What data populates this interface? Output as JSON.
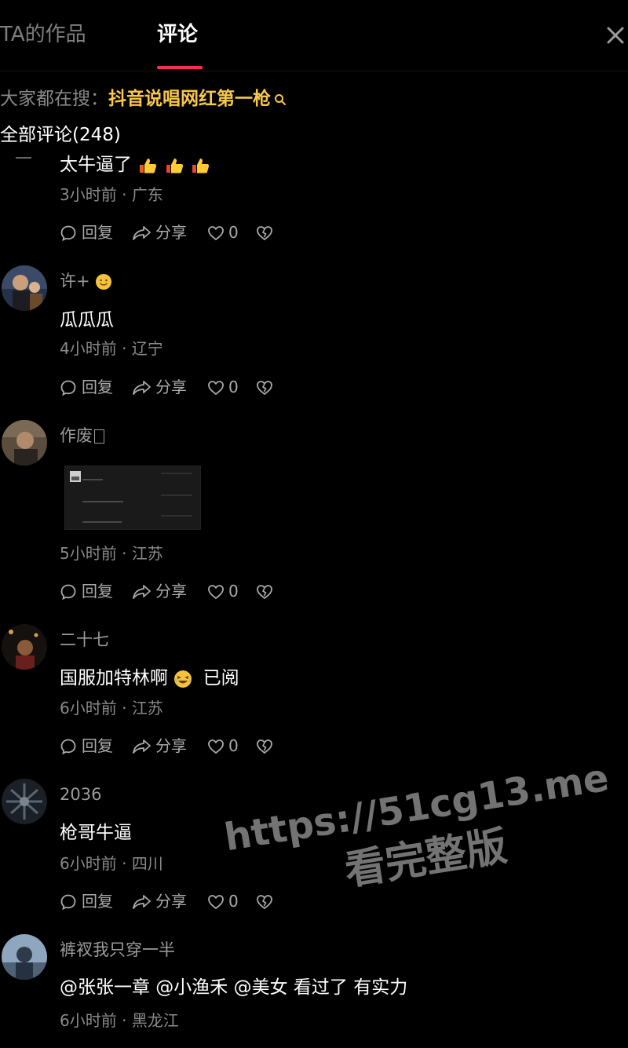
{
  "tabs": {
    "works": "TA的作品",
    "comments": "评论"
  },
  "search": {
    "label": "大家都在搜：",
    "term": "抖音说唱网红第一枪"
  },
  "comment_count": "全部评论(248)",
  "actions": {
    "reply": "回复",
    "share": "分享"
  },
  "colors": {
    "accent": "#fe2c55",
    "search_term": "#f7c84a",
    "background": "#000000"
  },
  "comments": [
    {
      "username": "",
      "text": "太牛逼了",
      "emoji_count": 3,
      "emoji": "thumbs-up",
      "time": "3小时前",
      "location": "广东",
      "likes": "0"
    },
    {
      "username": "许+",
      "text": "瓜瓜瓜",
      "time": "4小时前",
      "location": "辽宁",
      "likes": "0"
    },
    {
      "username": "作废",
      "text": "",
      "time": "5小时前",
      "location": "江苏",
      "likes": "0",
      "has_image": true
    },
    {
      "username": "二十七",
      "text": "国服加特林啊",
      "text_after": "已阅",
      "time": "6小时前",
      "location": "江苏",
      "likes": "0"
    },
    {
      "username": "2036",
      "text": "枪哥牛逼",
      "time": "6小时前",
      "location": "四川",
      "likes": "0"
    },
    {
      "username": "裤衩我只穿一半",
      "text": "@张张一章  @小渔禾  @美女  看过了 有实力",
      "time": "6小时前",
      "location": "黑龙江"
    }
  ],
  "watermark": {
    "line1": "https://51cg13.me",
    "line2": "看完整版"
  }
}
